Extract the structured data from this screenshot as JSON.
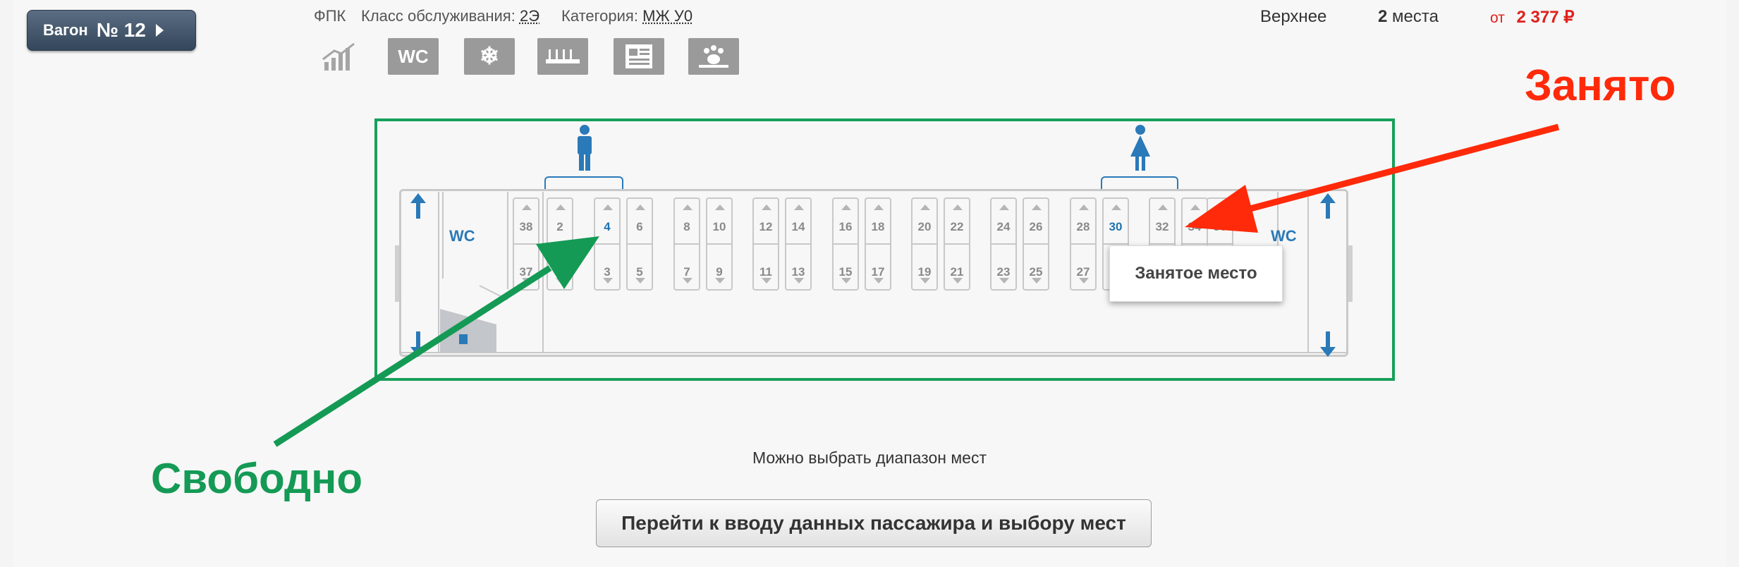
{
  "wagon": {
    "label": "Вагон",
    "number": "№ 12"
  },
  "meta": {
    "carrier": "ФПК",
    "class_label": "Класс обслуживания:",
    "class_value": "2Э",
    "category_label": "Категория:",
    "category_value": "МЖ У0"
  },
  "amenities": [
    "chart-icon",
    "wc-icon",
    "snowflake-icon",
    "washbasin-icon",
    "newspaper-icon",
    "pet-icon"
  ],
  "amenity_wc_text": "WC",
  "price": {
    "berth": "Верхнее",
    "count": "2",
    "count_unit": "места",
    "from": "от",
    "amount": "2 377 ₽"
  },
  "car": {
    "wc_left": "WC",
    "wc_right": "WC",
    "seats": [
      {
        "upper": "38",
        "lower": "37",
        "upper_free": false
      },
      {
        "upper": "2",
        "lower": "1",
        "upper_free": false
      },
      {
        "upper": "4",
        "lower": "3",
        "upper_free": true
      },
      {
        "upper": "6",
        "lower": "5",
        "upper_free": false
      },
      {
        "upper": "8",
        "lower": "7",
        "upper_free": false
      },
      {
        "upper": "10",
        "lower": "9",
        "upper_free": false
      },
      {
        "upper": "12",
        "lower": "11",
        "upper_free": false
      },
      {
        "upper": "14",
        "lower": "13",
        "upper_free": false
      },
      {
        "upper": "16",
        "lower": "15",
        "upper_free": false
      },
      {
        "upper": "18",
        "lower": "17",
        "upper_free": false
      },
      {
        "upper": "20",
        "lower": "19",
        "upper_free": false
      },
      {
        "upper": "22",
        "lower": "21",
        "upper_free": false
      },
      {
        "upper": "24",
        "lower": "23",
        "upper_free": false
      },
      {
        "upper": "26",
        "lower": "25",
        "upper_free": false
      },
      {
        "upper": "28",
        "lower": "27",
        "upper_free": false
      },
      {
        "upper": "30",
        "lower": "",
        "upper_free": true
      },
      {
        "upper": "32",
        "lower": "",
        "upper_free": false
      },
      {
        "upper": "34",
        "lower": "",
        "upper_free": false
      },
      {
        "upper": "36",
        "lower": "",
        "upper_free": false
      }
    ],
    "tooltip": "Занятое место"
  },
  "hint": "Можно выбрать диапазон мест",
  "submit_label": "Перейти к вводу данных пассажира и выбору мест",
  "annotations": {
    "occupied": "Занято",
    "free": "Свободно"
  },
  "colors": {
    "free_seat": "#1f74b0",
    "frame": "#17a05a",
    "annot_red": "#ff2a0a",
    "annot_green": "#149a55",
    "price": "#e0201b"
  }
}
